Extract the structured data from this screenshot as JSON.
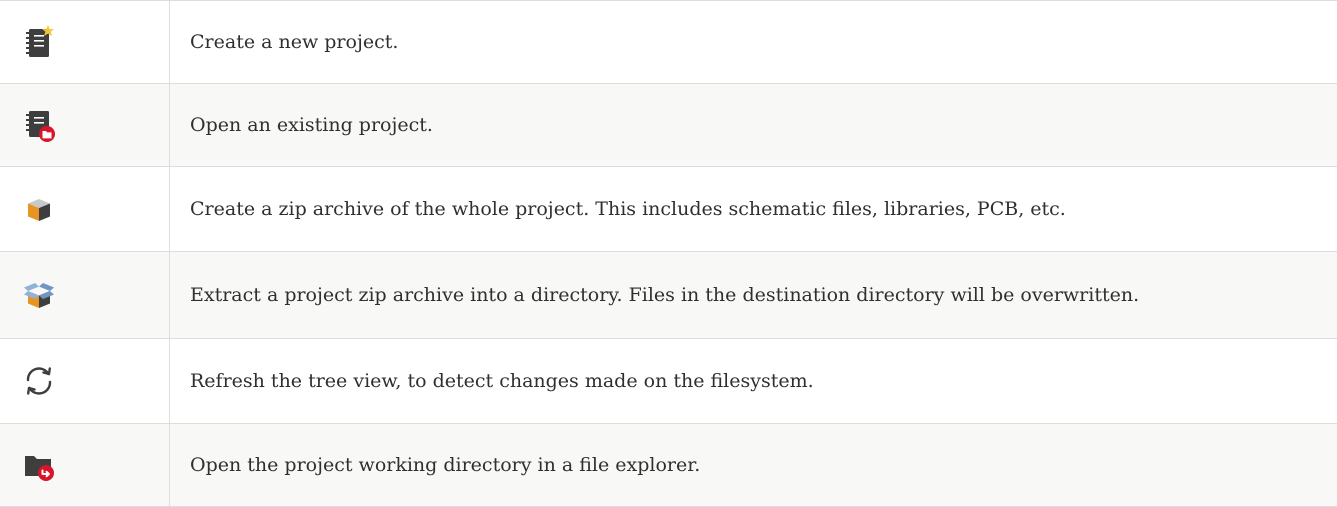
{
  "rows": [
    {
      "icon": "new-project-icon",
      "description": "Create a new project."
    },
    {
      "icon": "open-project-icon",
      "description": "Open an existing project."
    },
    {
      "icon": "archive-project-icon",
      "description": "Create a zip archive of the whole project. This includes schematic files, libraries, PCB, etc."
    },
    {
      "icon": "unarchive-project-icon",
      "description": "Extract a project zip archive into a directory. Files in the destination directory will be overwritten."
    },
    {
      "icon": "refresh-icon",
      "description": "Refresh the tree view, to detect changes made on the filesystem."
    },
    {
      "icon": "open-working-directory-icon",
      "description": "Open the project working directory in a file explorer."
    }
  ],
  "colors": {
    "text": "#2f2f2f",
    "border": "#dddddd",
    "row_alt": "#f8f8f7",
    "icon_dark": "#3e3e3e",
    "icon_red": "#d8152b",
    "icon_orange": "#e89423",
    "icon_blue": "#8fb3d9",
    "icon_gold": "#f5c236"
  }
}
